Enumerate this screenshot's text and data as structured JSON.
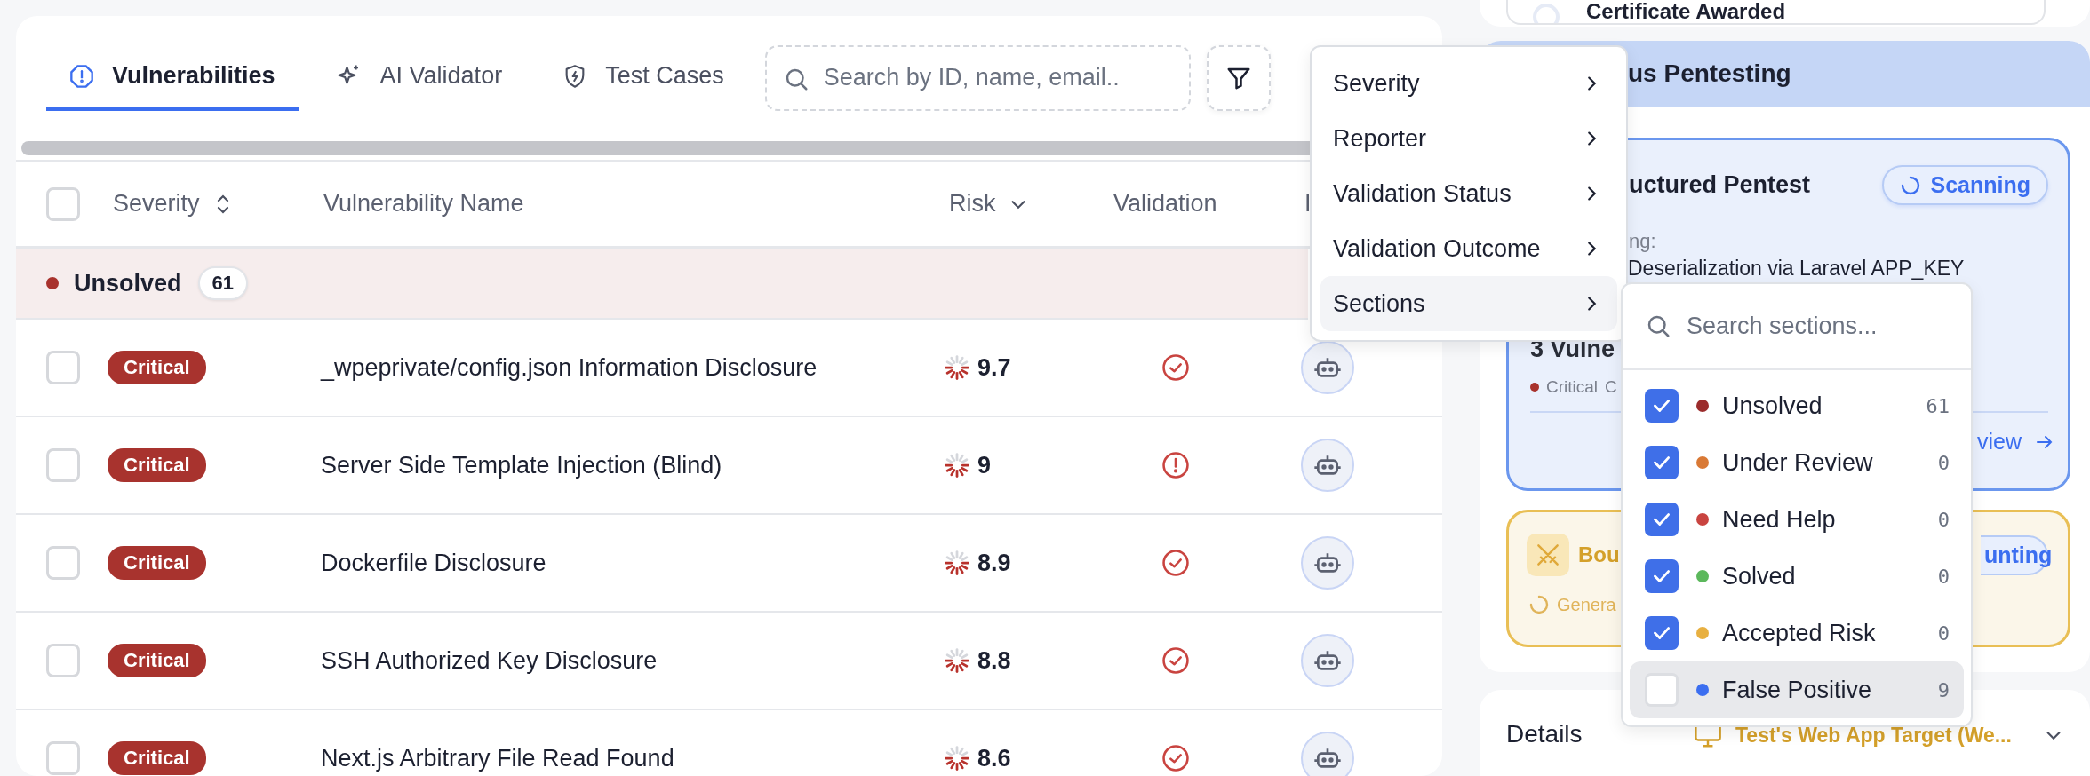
{
  "tabs": [
    {
      "label": "Vulnerabilities",
      "selected": true
    },
    {
      "label": "AI Validator",
      "selected": false
    },
    {
      "label": "Test Cases",
      "selected": false
    }
  ],
  "search": {
    "placeholder": "Search by ID, name, email.."
  },
  "table": {
    "select_all": {
      "checked": false
    },
    "columns": [
      "Severity",
      "Vulnerability Name",
      "Risk",
      "Validation",
      "I"
    ],
    "group": {
      "label": "Unsolved",
      "count": "61",
      "color": "#a8322d"
    },
    "rows": [
      {
        "checked": false,
        "severity": "Critical",
        "name": "_wpeprivate/config.json Information Disclosure",
        "risk": "9.7",
        "validation": {
          "kind": "check"
        }
      },
      {
        "checked": false,
        "severity": "Critical",
        "name": "Server Side Template Injection (Blind)",
        "risk": "9",
        "validation": {
          "kind": "alert"
        }
      },
      {
        "checked": false,
        "severity": "Critical",
        "name": "Dockerfile Disclosure",
        "risk": "8.9",
        "validation": {
          "kind": "check"
        }
      },
      {
        "checked": false,
        "severity": "Critical",
        "name": "SSH Authorized Key Disclosure",
        "risk": "8.8",
        "validation": {
          "kind": "check"
        }
      },
      {
        "checked": false,
        "severity": "Critical",
        "name": "Next.js Arbitrary File Read Found",
        "risk": "8.6",
        "validation": {
          "kind": "check"
        }
      }
    ]
  },
  "filter_menu": {
    "items": [
      {
        "label": "Severity",
        "selected": false
      },
      {
        "label": "Reporter",
        "selected": false
      },
      {
        "label": "Validation Status",
        "selected": false
      },
      {
        "label": "Validation Outcome",
        "selected": false
      },
      {
        "label": "Sections",
        "selected": true
      }
    ]
  },
  "sections_menu": {
    "placeholder": "Search sections...",
    "items": [
      {
        "label": "Unsolved",
        "count": "61",
        "checked": true,
        "color": "#9b2c2c",
        "selected": false
      },
      {
        "label": "Under Review",
        "count": "0",
        "checked": true,
        "color": "#d97935",
        "selected": false
      },
      {
        "label": "Need Help",
        "count": "0",
        "checked": true,
        "color": "#c94440",
        "selected": false
      },
      {
        "label": "Solved",
        "count": "0",
        "checked": true,
        "color": "#5cb85c",
        "selected": false
      },
      {
        "label": "Accepted Risk",
        "count": "0",
        "checked": true,
        "color": "#e8b040",
        "selected": false
      },
      {
        "label": "False Positive",
        "count": "9",
        "checked": false,
        "color": "#3b6ef0",
        "selected": true
      }
    ]
  },
  "side": {
    "top_card": {
      "title": "Certificate Awarded"
    },
    "pentesting": {
      "title": "us Pentesting",
      "card": {
        "title": "uctured Pentest",
        "status": "Scanning",
        "label": "ng:",
        "current": "Deserialization via Laravel APP_KEY",
        "count_text": "3 Vulne",
        "severity": "Critical",
        "extra": "C",
        "link": "view"
      }
    },
    "bounty": {
      "title": "Bou",
      "status": "unting",
      "note": "Genera"
    },
    "details": {
      "label": "Details",
      "target": "Test's Web App Target (We..."
    }
  }
}
